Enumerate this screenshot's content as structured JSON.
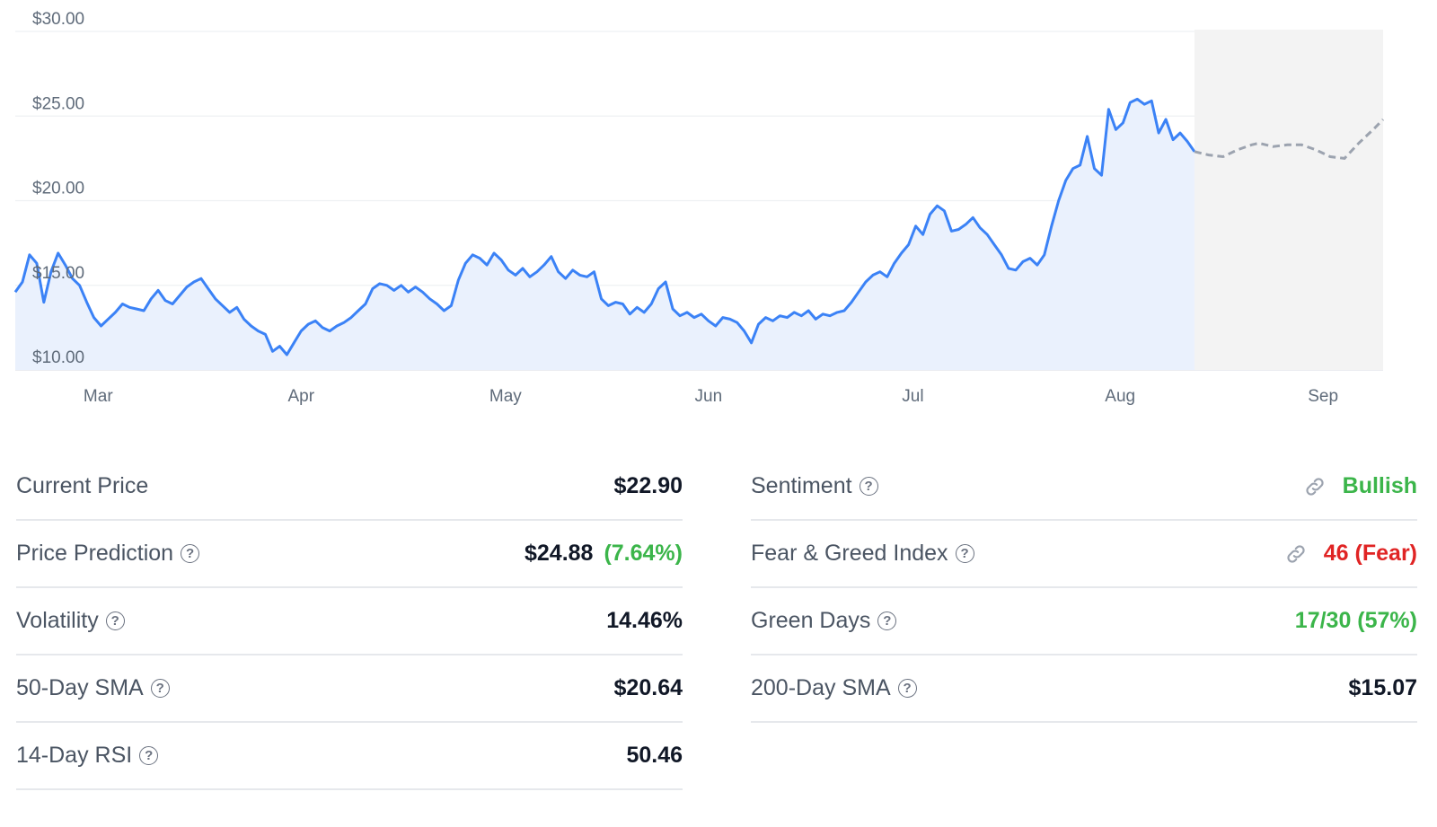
{
  "chart_data": {
    "type": "line",
    "y_ticks": [
      "$10.00",
      "$15.00",
      "$20.00",
      "$25.00",
      "$30.00"
    ],
    "x_ticks": [
      "Mar",
      "Apr",
      "May",
      "Jun",
      "Jul",
      "Aug",
      "Sep"
    ],
    "ylim": [
      10,
      30
    ],
    "grid": true,
    "series": [
      {
        "kind": "historical",
        "color": "#3b82f6",
        "points": [
          [
            0.0,
            14.6
          ],
          [
            0.5,
            15.2
          ],
          [
            1.0,
            16.8
          ],
          [
            1.5,
            16.3
          ],
          [
            2.0,
            14.0
          ],
          [
            2.5,
            15.8
          ],
          [
            3.0,
            16.9
          ],
          [
            3.5,
            16.2
          ],
          [
            4.0,
            15.4
          ],
          [
            4.5,
            15.0
          ],
          [
            5.0,
            14.0
          ],
          [
            5.5,
            13.1
          ],
          [
            6.0,
            12.6
          ],
          [
            6.5,
            13.0
          ],
          [
            7.0,
            13.4
          ],
          [
            7.5,
            13.9
          ],
          [
            8.0,
            13.7
          ],
          [
            8.5,
            13.6
          ],
          [
            9.0,
            13.5
          ],
          [
            9.5,
            14.2
          ],
          [
            10.0,
            14.7
          ],
          [
            10.5,
            14.1
          ],
          [
            11.0,
            13.9
          ],
          [
            11.5,
            14.4
          ],
          [
            12.0,
            14.9
          ],
          [
            12.5,
            15.2
          ],
          [
            13.0,
            15.4
          ],
          [
            13.5,
            14.8
          ],
          [
            14.0,
            14.2
          ],
          [
            14.5,
            13.8
          ],
          [
            15.0,
            13.4
          ],
          [
            15.5,
            13.7
          ],
          [
            16.0,
            13.0
          ],
          [
            16.5,
            12.6
          ],
          [
            17.0,
            12.3
          ],
          [
            17.5,
            12.1
          ],
          [
            18.0,
            11.1
          ],
          [
            18.5,
            11.4
          ],
          [
            19.0,
            10.9
          ],
          [
            19.5,
            11.6
          ],
          [
            20.0,
            12.3
          ],
          [
            20.5,
            12.7
          ],
          [
            21.0,
            12.9
          ],
          [
            21.5,
            12.5
          ],
          [
            22.0,
            12.3
          ],
          [
            22.5,
            12.6
          ],
          [
            23.0,
            12.8
          ],
          [
            23.5,
            13.1
          ],
          [
            24.0,
            13.5
          ],
          [
            24.5,
            13.9
          ],
          [
            25.0,
            14.8
          ],
          [
            25.5,
            15.1
          ],
          [
            26.0,
            15.0
          ],
          [
            26.5,
            14.7
          ],
          [
            27.0,
            15.0
          ],
          [
            27.5,
            14.6
          ],
          [
            28.0,
            14.9
          ],
          [
            28.5,
            14.6
          ],
          [
            29.0,
            14.2
          ],
          [
            29.5,
            13.9
          ],
          [
            30.0,
            13.5
          ],
          [
            30.5,
            13.8
          ],
          [
            31.0,
            15.3
          ],
          [
            31.5,
            16.3
          ],
          [
            32.0,
            16.8
          ],
          [
            32.5,
            16.6
          ],
          [
            33.0,
            16.2
          ],
          [
            33.5,
            16.9
          ],
          [
            34.0,
            16.5
          ],
          [
            34.5,
            15.9
          ],
          [
            35.0,
            15.6
          ],
          [
            35.5,
            16.0
          ],
          [
            36.0,
            15.5
          ],
          [
            36.5,
            15.8
          ],
          [
            37.0,
            16.2
          ],
          [
            37.5,
            16.7
          ],
          [
            38.0,
            15.8
          ],
          [
            38.5,
            15.4
          ],
          [
            39.0,
            15.9
          ],
          [
            39.5,
            15.6
          ],
          [
            40.0,
            15.5
          ],
          [
            40.5,
            15.8
          ],
          [
            41.0,
            14.2
          ],
          [
            41.5,
            13.8
          ],
          [
            42.0,
            14.0
          ],
          [
            42.5,
            13.9
          ],
          [
            43.0,
            13.3
          ],
          [
            43.5,
            13.7
          ],
          [
            44.0,
            13.4
          ],
          [
            44.5,
            13.9
          ],
          [
            45.0,
            14.8
          ],
          [
            45.5,
            15.2
          ],
          [
            46.0,
            13.6
          ],
          [
            46.5,
            13.2
          ],
          [
            47.0,
            13.4
          ],
          [
            47.5,
            13.1
          ],
          [
            48.0,
            13.3
          ],
          [
            48.5,
            12.9
          ],
          [
            49.0,
            12.6
          ],
          [
            49.5,
            13.1
          ],
          [
            50.0,
            13.0
          ],
          [
            50.5,
            12.8
          ],
          [
            51.0,
            12.3
          ],
          [
            51.5,
            11.6
          ],
          [
            52.0,
            12.7
          ],
          [
            52.5,
            13.1
          ],
          [
            53.0,
            12.9
          ],
          [
            53.5,
            13.2
          ],
          [
            54.0,
            13.1
          ],
          [
            54.5,
            13.4
          ],
          [
            55.0,
            13.2
          ],
          [
            55.5,
            13.5
          ],
          [
            56.0,
            13.0
          ],
          [
            56.5,
            13.3
          ],
          [
            57.0,
            13.2
          ],
          [
            57.5,
            13.4
          ],
          [
            58.0,
            13.5
          ],
          [
            58.5,
            14.0
          ],
          [
            59.0,
            14.6
          ],
          [
            59.5,
            15.2
          ],
          [
            60.0,
            15.6
          ],
          [
            60.5,
            15.8
          ],
          [
            61.0,
            15.5
          ],
          [
            61.5,
            16.3
          ],
          [
            62.0,
            16.9
          ],
          [
            62.5,
            17.4
          ],
          [
            63.0,
            18.5
          ],
          [
            63.5,
            18.0
          ],
          [
            64.0,
            19.2
          ],
          [
            64.5,
            19.7
          ],
          [
            65.0,
            19.4
          ],
          [
            65.5,
            18.2
          ],
          [
            66.0,
            18.3
          ],
          [
            66.5,
            18.6
          ],
          [
            67.0,
            19.0
          ],
          [
            67.5,
            18.4
          ],
          [
            68.0,
            18.0
          ],
          [
            68.5,
            17.4
          ],
          [
            69.0,
            16.8
          ],
          [
            69.5,
            16.0
          ],
          [
            70.0,
            15.9
          ],
          [
            70.5,
            16.4
          ],
          [
            71.0,
            16.6
          ],
          [
            71.5,
            16.2
          ],
          [
            72.0,
            16.8
          ],
          [
            72.5,
            18.5
          ],
          [
            73.0,
            20.0
          ],
          [
            73.5,
            21.2
          ],
          [
            74.0,
            21.9
          ],
          [
            74.5,
            22.1
          ],
          [
            75.0,
            23.8
          ],
          [
            75.5,
            21.9
          ],
          [
            76.0,
            21.5
          ],
          [
            76.5,
            25.4
          ],
          [
            77.0,
            24.2
          ],
          [
            77.5,
            24.6
          ],
          [
            78.0,
            25.8
          ],
          [
            78.5,
            26.0
          ],
          [
            79.0,
            25.7
          ],
          [
            79.5,
            25.9
          ],
          [
            80.0,
            24.0
          ],
          [
            80.5,
            24.8
          ],
          [
            81.0,
            23.6
          ],
          [
            81.5,
            24.0
          ],
          [
            82.0,
            23.5
          ],
          [
            82.5,
            22.9
          ]
        ]
      },
      {
        "kind": "prediction",
        "color": "#9ca3af",
        "points": [
          [
            82.5,
            22.9
          ],
          [
            83.5,
            22.7
          ],
          [
            84.5,
            22.6
          ],
          [
            85.5,
            23.0
          ],
          [
            86.5,
            23.3
          ],
          [
            87.0,
            23.4
          ],
          [
            88.0,
            23.2
          ],
          [
            89.0,
            23.3
          ],
          [
            90.0,
            23.3
          ],
          [
            91.0,
            23.0
          ],
          [
            92.0,
            22.6
          ],
          [
            93.0,
            22.5
          ],
          [
            94.0,
            23.4
          ],
          [
            95.0,
            24.2
          ],
          [
            95.7,
            24.8
          ]
        ]
      }
    ]
  },
  "stats_left": [
    {
      "label": "Current Price",
      "help": false,
      "value": "$22.90",
      "extra": "",
      "value_class": ""
    },
    {
      "label": "Price Prediction",
      "help": true,
      "value": "$24.88",
      "extra": "(7.64%)",
      "value_class": ""
    },
    {
      "label": "Volatility",
      "help": true,
      "value": "14.46%",
      "extra": "",
      "value_class": ""
    },
    {
      "label": "50-Day SMA",
      "help": true,
      "value": "$20.64",
      "extra": "",
      "value_class": ""
    },
    {
      "label": "14-Day RSI",
      "help": true,
      "value": "50.46",
      "extra": "",
      "value_class": ""
    }
  ],
  "stats_right": [
    {
      "label": "Sentiment",
      "help": true,
      "value": "Bullish",
      "icon": "link-icon",
      "value_class": "green"
    },
    {
      "label": "Fear & Greed Index",
      "help": true,
      "value": "46 (Fear)",
      "icon": "link-icon",
      "value_class": "red"
    },
    {
      "label": "Green Days",
      "help": true,
      "value": "17/30 (57%)",
      "icon": "",
      "value_class": "green"
    },
    {
      "label": "200-Day SMA",
      "help": true,
      "value": "$15.07",
      "icon": "",
      "value_class": ""
    }
  ],
  "colors": {
    "line": "#3b82f6",
    "area": "#eaf1fd",
    "prediction_area": "#f3f3f3",
    "positive": "#3bb54a",
    "negative": "#e02424"
  }
}
